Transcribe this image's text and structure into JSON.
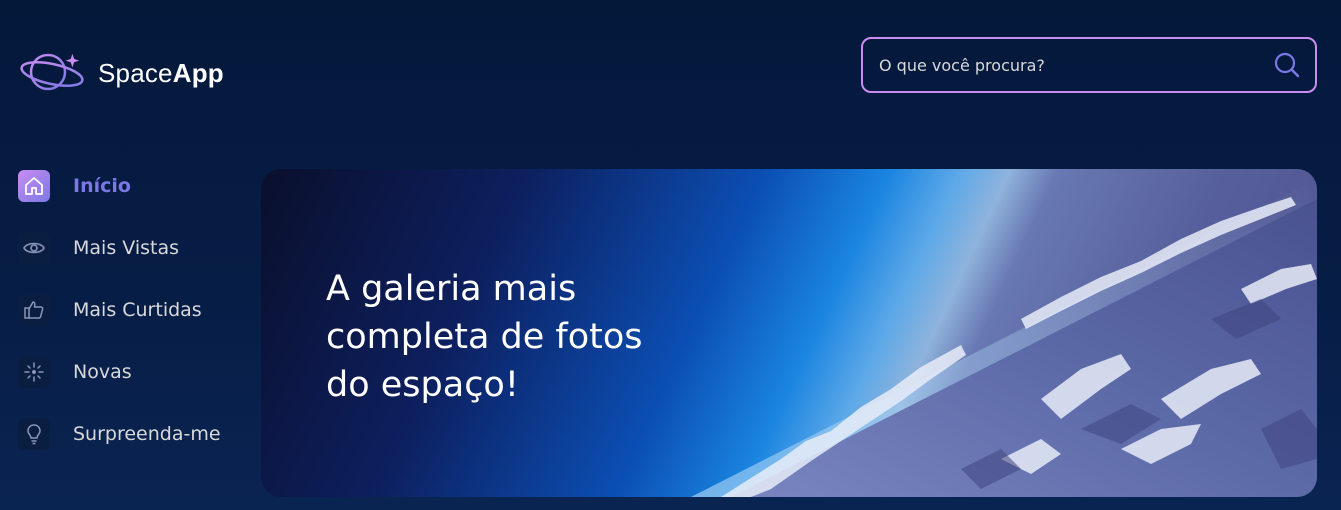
{
  "header": {
    "logo": {
      "text_light": "Space",
      "text_bold": "App",
      "icon": "planet-icon"
    },
    "search": {
      "placeholder": "O que você procura?",
      "value": "",
      "icon": "search-icon"
    }
  },
  "sidebar": {
    "items": [
      {
        "label": "Início",
        "icon": "home-icon",
        "active": true
      },
      {
        "label": "Mais Vistas",
        "icon": "eye-icon",
        "active": false
      },
      {
        "label": "Mais Curtidas",
        "icon": "thumbs-up-icon",
        "active": false
      },
      {
        "label": "Novas",
        "icon": "sparkle-icon",
        "active": false
      },
      {
        "label": "Surpreenda-me",
        "icon": "lightbulb-icon",
        "active": false
      }
    ]
  },
  "banner": {
    "title": "A galeria mais completa de fotos do espaço!"
  },
  "colors": {
    "accent": "#c98cf1",
    "active_text": "#7b78e5",
    "text": "#d9d9d9",
    "background": "#04183a"
  }
}
